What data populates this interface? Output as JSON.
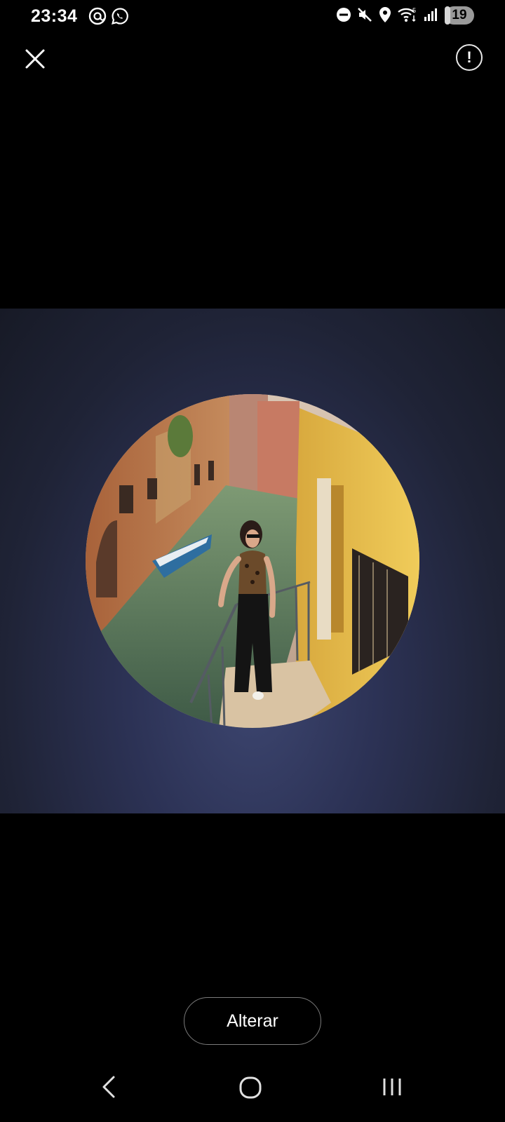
{
  "status_bar": {
    "time": "23:34",
    "battery_level": "19",
    "battery_fraction": 0.19,
    "left_icons": [
      "threads-icon",
      "whatsapp-icon"
    ],
    "right_icons": [
      "do-not-disturb-icon",
      "mute-icon",
      "location-icon",
      "wifi-icon",
      "signal-icon",
      "signal-icon"
    ]
  },
  "top_bar": {
    "close_icon": "close-icon",
    "report_symbol": "!"
  },
  "profile_photo": {
    "subject": "profile-photo"
  },
  "actions": {
    "change_label": "Alterar"
  },
  "nav_bar": {
    "buttons": [
      "back-icon",
      "home-icon",
      "recents-icon"
    ]
  },
  "colors": {
    "background": "#000000",
    "panel_center": "#3d4670",
    "panel_edge": "#171a26",
    "button_border": "#7b7b7b"
  }
}
